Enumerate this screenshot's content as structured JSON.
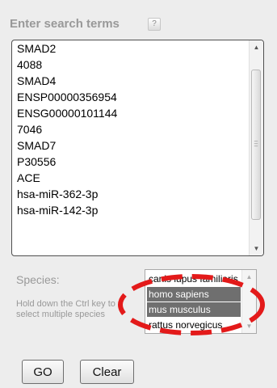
{
  "search": {
    "title": "Enter search terms",
    "help_label": "?",
    "terms": [
      "SMAD2",
      "4088",
      "SMAD4",
      "ENSP00000356954",
      "ENSG00000101144",
      "7046",
      "SMAD7",
      "P30556",
      "ACE",
      "hsa-miR-362-3p",
      "hsa-miR-142-3p"
    ]
  },
  "species": {
    "label": "Species:",
    "hint": "Hold down the Ctrl key to select multiple species",
    "options": [
      {
        "label": "canis lupus familiaris",
        "selected": false
      },
      {
        "label": "homo sapiens",
        "selected": true
      },
      {
        "label": "mus musculus",
        "selected": true
      },
      {
        "label": "rattus norvegicus",
        "selected": false
      }
    ]
  },
  "buttons": {
    "go_label": "GO",
    "clear_label": "Clear"
  },
  "colors": {
    "selected_bg": "#6f6f6f",
    "annotation": "#e31a1a"
  }
}
